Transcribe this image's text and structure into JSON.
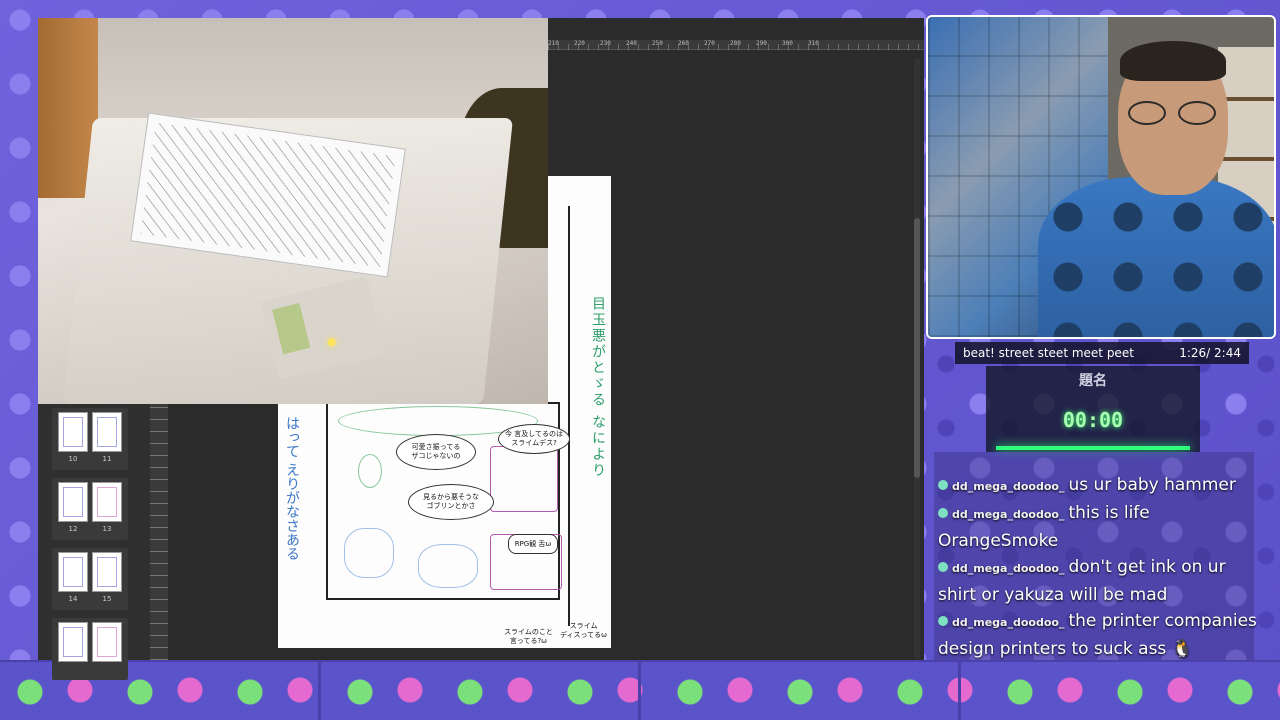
{
  "editor": {
    "ruler_labels": [
      "210",
      "220",
      "230",
      "240",
      "250",
      "260",
      "270",
      "280",
      "290",
      "300",
      "310"
    ],
    "page_thumbnails": [
      {
        "left": "10",
        "right": "11"
      },
      {
        "left": "12",
        "right": "13"
      },
      {
        "left": "14",
        "right": "15"
      },
      {
        "left": "",
        "right": ""
      }
    ]
  },
  "manga": {
    "bubble_1": "可愛さ振ってる\nザコじゃないの",
    "bubble_2": "今 言及してるのは\nスライムデス?",
    "bubble_3": "見るから悪そうな\nゴブリンとかさ",
    "bubble_4": "RPG観 舌ω",
    "caption_1": "スライムのこと\n言ってる?ω",
    "caption_2": "スライム\nディスってるω",
    "green_note": "目玉悪がとゞる なにより",
    "blue_note": "はって えりがなさある"
  },
  "now_playing": {
    "title": "beat! street steet meet peet",
    "time": "1:26/ 2:44"
  },
  "timer": {
    "title": "題名",
    "value": "00:00"
  },
  "chat": [
    {
      "user": "dd_mega_doodoo_",
      "text": "us ur baby hammer"
    },
    {
      "user": "dd_mega_doodoo_",
      "text": "this is life OrangeSmoke"
    },
    {
      "user": "dd_mega_doodoo_",
      "text": "don't get ink on ur shirt or yakuza will be mad"
    },
    {
      "user": "dd_mega_doodoo_",
      "text": "the printer companies design printers to suck ass 🐧"
    }
  ]
}
